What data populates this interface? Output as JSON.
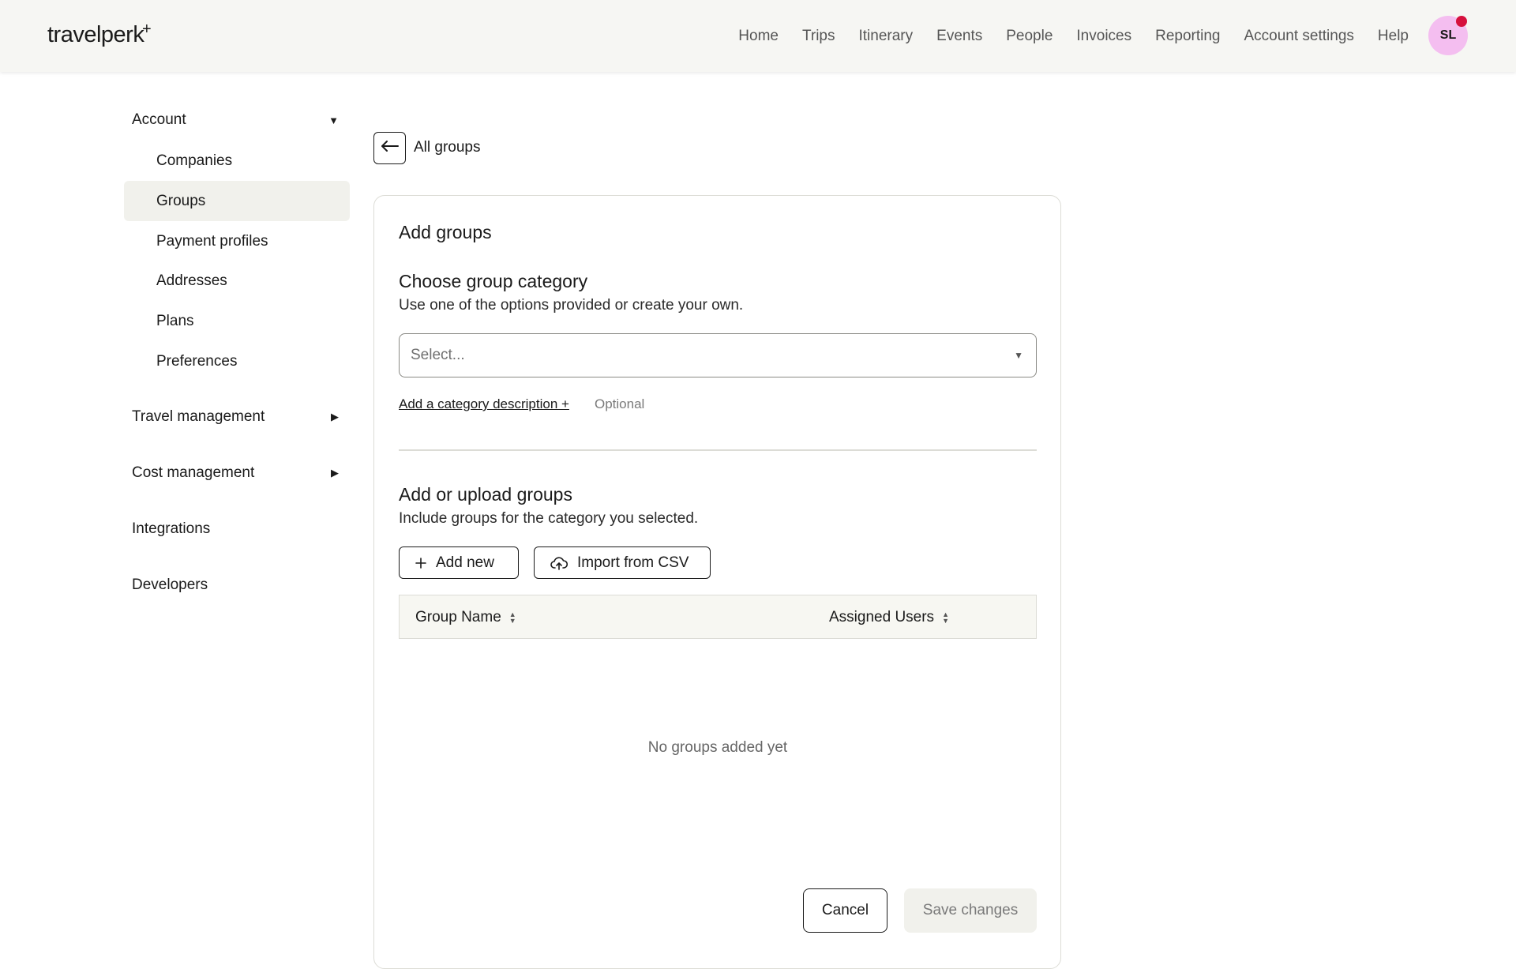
{
  "brand": {
    "logo_text": "travelperk",
    "logo_plus": "+"
  },
  "nav": {
    "items": [
      "Home",
      "Trips",
      "Itinerary",
      "Events",
      "People",
      "Invoices",
      "Reporting",
      "Account settings",
      "Help"
    ],
    "avatar_initials": "SL"
  },
  "sidebar": {
    "account": {
      "label": "Account",
      "caret": "▼"
    },
    "account_items": [
      "Companies",
      "Groups",
      "Payment profiles",
      "Addresses",
      "Plans",
      "Preferences"
    ],
    "active_item": "Groups",
    "travel_management": {
      "label": "Travel management",
      "caret": "▶"
    },
    "cost_management": {
      "label": "Cost management",
      "caret": "▶"
    },
    "integrations": {
      "label": "Integrations"
    },
    "developers": {
      "label": "Developers"
    }
  },
  "back": {
    "label": "All groups",
    "icon": "arrow-left-icon"
  },
  "card": {
    "title": "Add groups",
    "category": {
      "title": "Choose group category",
      "subtitle": "Use one of the options provided or create your own.",
      "select_placeholder": "Select...",
      "add_description_link": "Add a category description +",
      "optional_label": "Optional"
    },
    "upload": {
      "title": "Add or upload groups",
      "subtitle": "Include groups for the category you selected.",
      "add_new_label": "Add new",
      "import_label": "Import from CSV"
    },
    "table": {
      "columns": [
        "Group Name",
        "Assigned Users"
      ],
      "empty_message": "No groups added yet"
    },
    "actions": {
      "cancel_label": "Cancel",
      "save_label": "Save changes"
    }
  },
  "colors": {
    "topbar_bg": "#f6f6f3",
    "avatar_bg": "#f4bef0",
    "notification_dot": "#d6103d",
    "active_item_bg": "#f1f1ec",
    "save_disabled_bg": "#f1f1ec"
  }
}
